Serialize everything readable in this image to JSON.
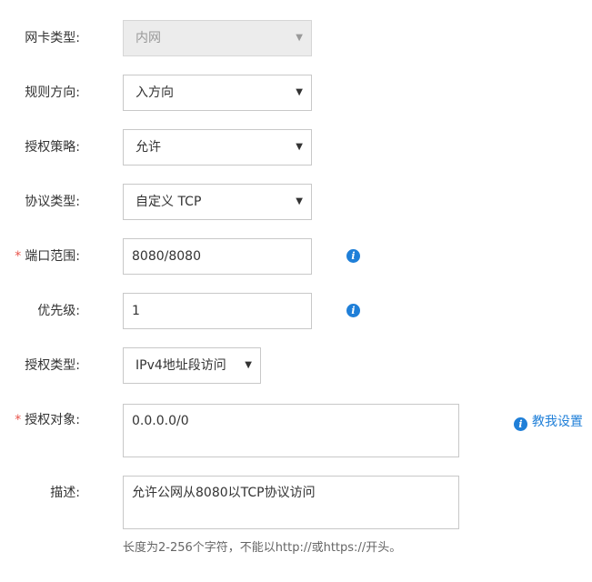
{
  "form": {
    "nic_type": {
      "label": "网卡类型:",
      "value": "内网"
    },
    "rule_direction": {
      "label": "规则方向:",
      "value": "入方向"
    },
    "auth_policy": {
      "label": "授权策略:",
      "value": "允许"
    },
    "protocol_type": {
      "label": "协议类型:",
      "value": "自定义 TCP"
    },
    "port_range": {
      "required_mark": "*",
      "label": "端口范围:",
      "value": "8080/8080"
    },
    "priority": {
      "label": "优先级:",
      "value": "1"
    },
    "auth_type": {
      "label": "授权类型:",
      "value": "IPv4地址段访问"
    },
    "auth_object": {
      "required_mark": "*",
      "label": "授权对象:",
      "value": "0.0.0.0/0",
      "help_link": "教我设置"
    },
    "description": {
      "label": "描述:",
      "value": "允许公网从8080以TCP协议访问",
      "hint": "长度为2-256个字符，不能以http://或https://开头。"
    }
  },
  "icons": {
    "dropdown": "▼",
    "info": "i"
  },
  "colors": {
    "accent": "#1f7fd8",
    "required": "#e8534a",
    "disabled_bg": "#ececec"
  }
}
